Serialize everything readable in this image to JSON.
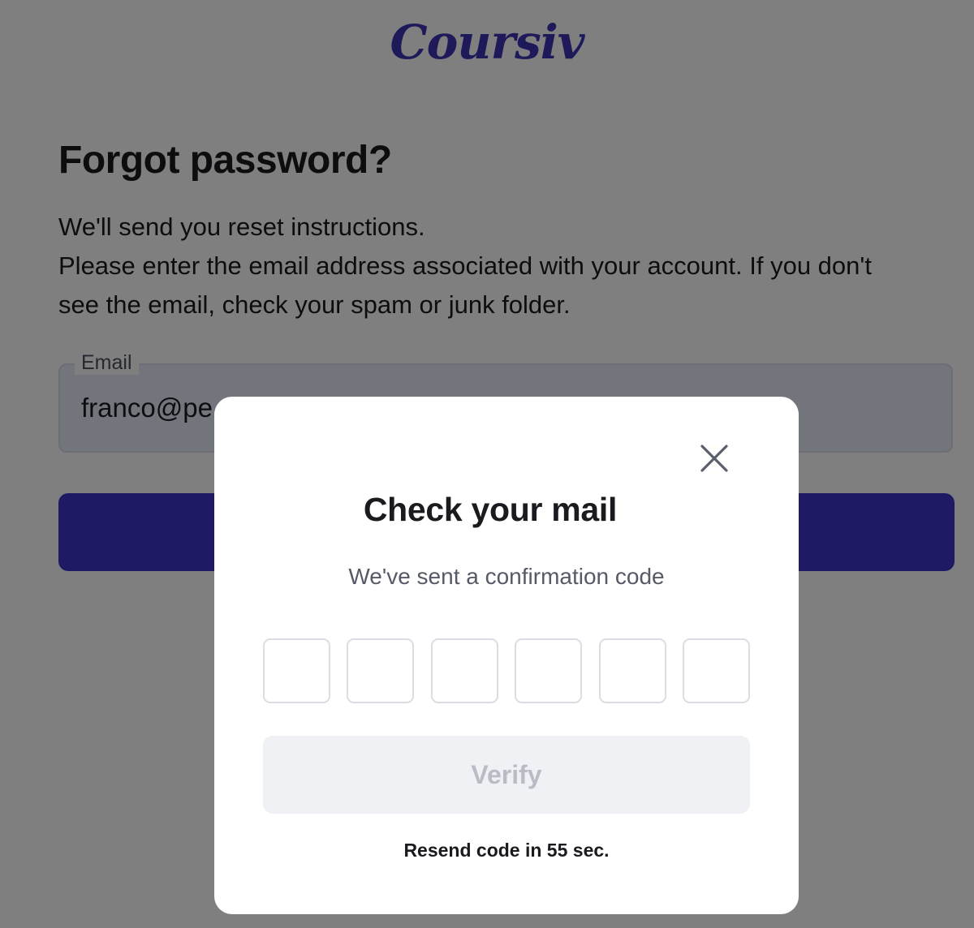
{
  "brand": {
    "logo_text": "Coursiv"
  },
  "forgot": {
    "title": "Forgot password?",
    "line1": "We'll send you reset instructions.",
    "line2": "Please enter the email address associated with your account. If you don't see the email, check your spam or junk folder.",
    "email_label": "Email",
    "email_value": "franco@pe"
  },
  "modal": {
    "title": "Check your mail",
    "subtitle": "We've sent a confirmation code",
    "code_digits": [
      "",
      "",
      "",
      "",
      "",
      ""
    ],
    "verify_label": "Verify",
    "resend_text": "Resend code in 55 sec."
  },
  "colors": {
    "brand": "#3c35b5",
    "primary_button": "#3d35c8",
    "overlay": "rgba(0,0,0,0.5)",
    "verify_disabled_bg": "#f0f1f4",
    "verify_disabled_text": "#b9bcc5"
  },
  "icons": {
    "close": "close-icon"
  }
}
